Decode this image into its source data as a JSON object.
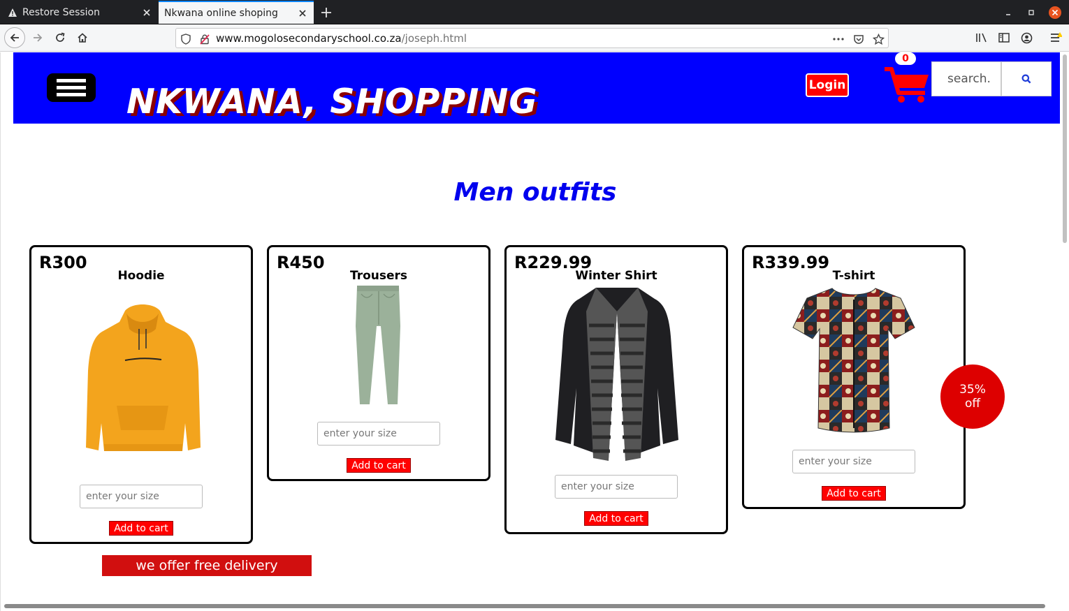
{
  "browser": {
    "tabs": [
      {
        "title": "Restore Session",
        "icon": "warning-icon",
        "active": false
      },
      {
        "title": "Nkwana online shoping",
        "active": true
      }
    ],
    "url_host": "www.mogolosecondaryschool.co.za",
    "url_path": "/joseph.html"
  },
  "header": {
    "brand": "NKWANA, SHOPPING",
    "login_label": "Login",
    "cart_count": "0",
    "search_placeholder": "search.",
    "colors": {
      "header_bg": "#0000ff",
      "accent": "#ff0000",
      "brand_shadow": "#8b0000"
    }
  },
  "main": {
    "section_title": "Men outfits",
    "products": [
      {
        "price": "R300",
        "name": "Hoodie",
        "size_placeholder": "enter your size",
        "button": "Add to cart"
      },
      {
        "price": "R450",
        "name": "Trousers",
        "size_placeholder": "enter your size",
        "button": "Add to cart"
      },
      {
        "price": "R229.99",
        "name": "Winter Shirt",
        "size_placeholder": "enter your size",
        "button": "Add to cart"
      },
      {
        "price": "R339.99",
        "name": "T-shirt",
        "size_placeholder": "enter your size",
        "button": "Add to cart"
      }
    ],
    "discount": {
      "line1": "35%",
      "line2": "off"
    },
    "delivery_banner": "we offer free delivery"
  }
}
